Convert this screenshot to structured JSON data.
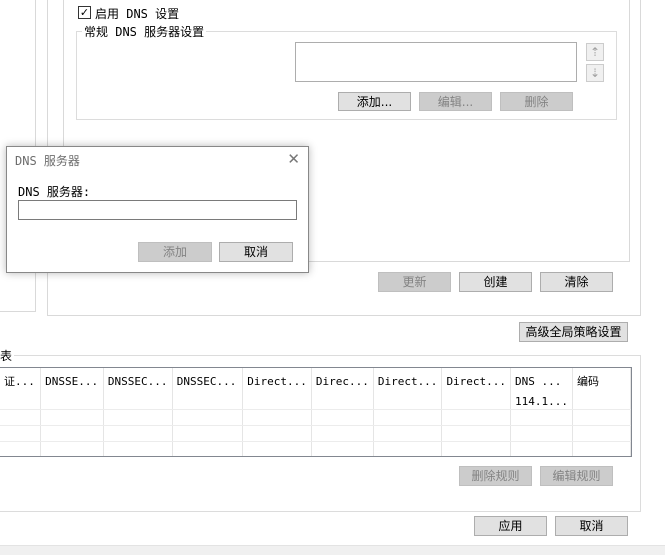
{
  "dns_settings": {
    "enable_checkbox_label": "启用 DNS 设置",
    "enable_checked": true,
    "general_group_label": "常规 DNS 服务器设置",
    "add_label": "添加...",
    "edit_label": "编辑...",
    "delete_label": "删除"
  },
  "policy_buttons": {
    "update_label": "更新",
    "create_label": "创建",
    "clear_label": "清除"
  },
  "advanced_button_label": "高级全局策略设置",
  "table_group_label_fragment": "表",
  "rules_table": {
    "columns": [
      "证...",
      "DNSSE...",
      "DNSSEC...",
      "DNSSEC...",
      "Direct...",
      "Direc...",
      "Direct...",
      "Direct...",
      "DNS ...",
      "编码"
    ],
    "rows": [
      [
        "",
        "",
        "",
        "",
        "",
        "",
        "",
        "",
        "114.1...",
        ""
      ],
      [
        "",
        "",
        "",
        "",
        "",
        "",
        "",
        "",
        "",
        ""
      ],
      [
        "",
        "",
        "",
        "",
        "",
        "",
        "",
        "",
        "",
        ""
      ],
      [
        "",
        "",
        "",
        "",
        "",
        "",
        "",
        "",
        "",
        ""
      ]
    ]
  },
  "rule_buttons": {
    "delete_rule_label": "删除规则",
    "edit_rule_label": "编辑规则"
  },
  "footer": {
    "apply_label": "应用",
    "cancel_label": "取消"
  },
  "dialog": {
    "title": "DNS 服务器",
    "close_glyph": "✕",
    "field_label": "DNS 服务器:",
    "field_value": "",
    "add_label": "添加",
    "cancel_label": "取消"
  }
}
